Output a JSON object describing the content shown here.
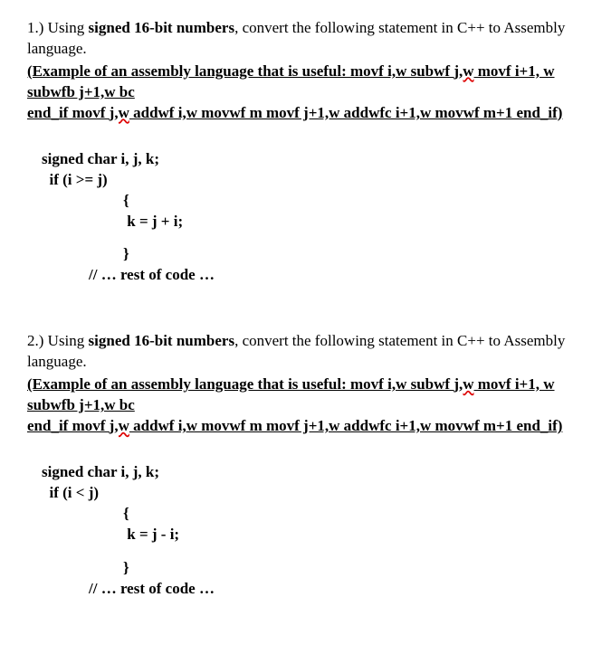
{
  "q1": {
    "num": "1.) Using ",
    "bold1": "signed 16-bit numbers",
    "intro_rest": ", convert the following statement in C++ to Assembly language.",
    "example_open": "(Example of an assembly language that is useful: movf i,w subwf ",
    "typo1": "j,w",
    "example_mid": " movf i+1, w subwfb j+1,w bc",
    "example_line2a": "end_if movf ",
    "typo2": "j,w",
    "example_line2b": " addwf i,w movwf m movf j+1,w addwfc i+1,w movwf m+1 end_if)",
    "code": {
      "l1": "signed char i, j, k;",
      "l2": "  if (i >= j)",
      "l3": "{",
      "l4": " k = j + i;",
      "l5": "}",
      "l6": "// … rest of code …"
    }
  },
  "q2": {
    "num": "2.) Using ",
    "bold1": "signed 16-bit numbers",
    "intro_rest": ", convert the following statement in C++ to Assembly language.",
    "example_open": "(Example of an assembly language that is useful: movf i,w subwf ",
    "typo1": "j,w",
    "example_mid": " movf i+1, w subwfb j+1,w bc",
    "example_line2a": "end_if movf ",
    "typo2": "j,w",
    "example_line2b": " addwf i,w movwf m movf j+1,w addwfc i+1,w movwf m+1 end_if)",
    "code": {
      "l1": "signed char i, j, k;",
      "l2": "  if (i < j)",
      "l3": "{",
      "l4": " k = j - i;",
      "l5": "}",
      "l6": "// … rest of code …"
    }
  }
}
